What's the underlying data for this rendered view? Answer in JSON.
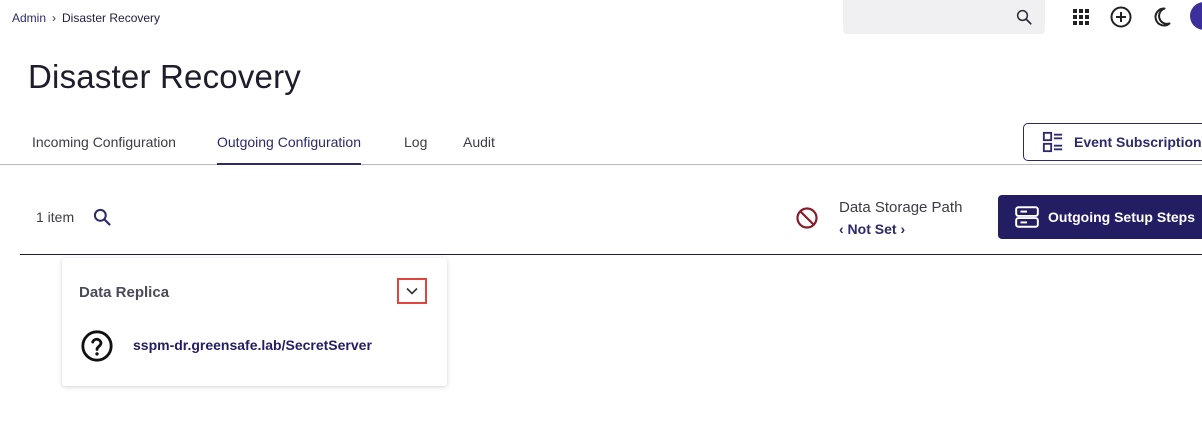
{
  "breadcrumb": {
    "parent": "Admin",
    "current": "Disaster Recovery"
  },
  "topbar": {
    "search_placeholder": "",
    "icons": [
      "apps-grid-icon",
      "add-circle-icon",
      "dark-mode-moon-icon",
      "avatar"
    ]
  },
  "page": {
    "title": "Disaster Recovery"
  },
  "tabs": [
    {
      "label": "Incoming Configuration",
      "active": false
    },
    {
      "label": "Outgoing Configuration",
      "active": true
    },
    {
      "label": "Log",
      "active": false
    },
    {
      "label": "Audit",
      "active": false
    }
  ],
  "event_subscription": {
    "label": "Event Subscription"
  },
  "list": {
    "count_label": "1 item"
  },
  "storage": {
    "title": "Data Storage Path",
    "value": "‹ Not Set ›"
  },
  "setup_button": {
    "label": "Outgoing Setup Steps"
  },
  "card": {
    "title": "Data Replica",
    "link": "sspm-dr.greensafe.lab/SecretServer"
  },
  "colors": {
    "primary": "#231d63",
    "accent_link": "#2c2a6b",
    "highlight": "#e0443d",
    "blocked": "#8b1a2a"
  }
}
